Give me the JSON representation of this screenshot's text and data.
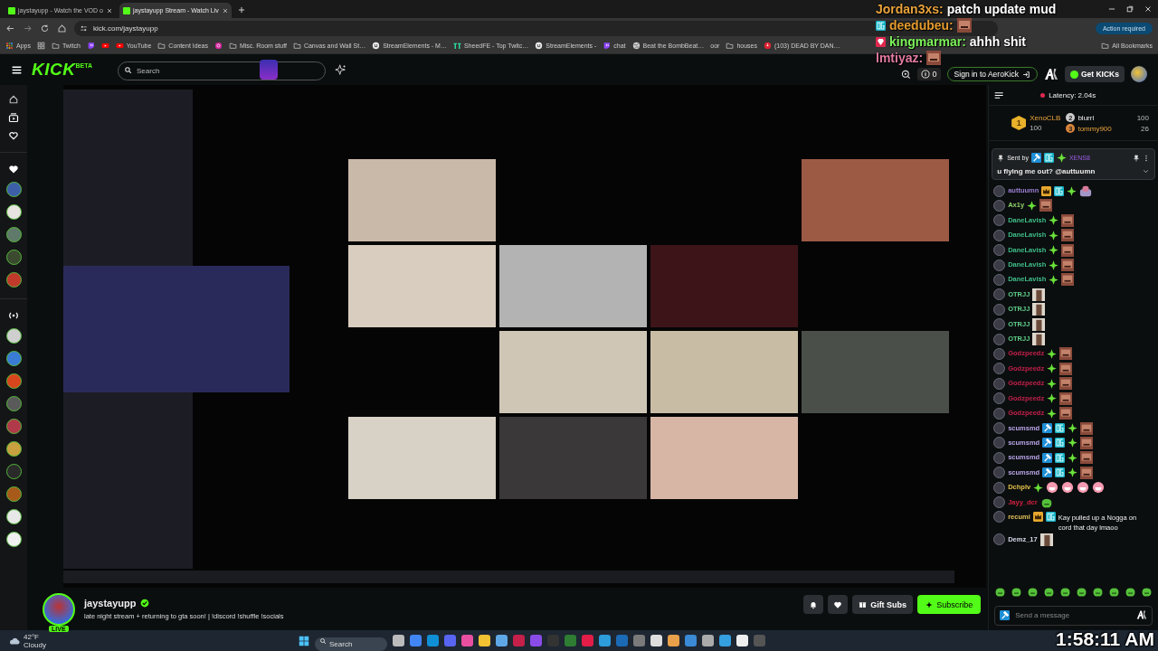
{
  "browser": {
    "tabs": [
      {
        "title": "jaystayupp - Watch the VOD o",
        "selected": false
      },
      {
        "title": "jaystayupp Stream - Watch Liv",
        "selected": true
      }
    ],
    "url": "kick.com/jaystayupp",
    "action_button": "Action required",
    "bookmarks": [
      {
        "kind": "apps",
        "label": "Apps"
      },
      {
        "kind": "grid"
      },
      {
        "kind": "folder",
        "label": "Twitch"
      },
      {
        "kind": "twitch"
      },
      {
        "kind": "youtube"
      },
      {
        "kind": "youtube",
        "label": "YouTube"
      },
      {
        "kind": "folder",
        "label": "Content Ideas"
      },
      {
        "kind": "instagram"
      },
      {
        "kind": "folder",
        "label": "Misc. Room stuff"
      },
      {
        "kind": "folder",
        "label": "Canvas and Wall St…"
      },
      {
        "kind": "face",
        "label": "StreamElements - M…"
      },
      {
        "kind": "tt",
        "label": "SheedFE - Top Twitc…"
      },
      {
        "kind": "face",
        "label": "StreamElements -"
      },
      {
        "kind": "twitch",
        "label": "chat"
      },
      {
        "kind": "globe",
        "label": "Beat the BombBeat…"
      },
      {
        "kind": "plain",
        "label": "oor"
      },
      {
        "kind": "folder",
        "label": "houses"
      },
      {
        "kind": "red",
        "label": "(103) DEAD BY DAN…"
      }
    ],
    "all_bookmarks": "All Bookmarks"
  },
  "header": {
    "logo": "KICK",
    "logo_badge": "BETA",
    "search": {
      "placeholder": "Search"
    },
    "counter": "0",
    "sign_in": "Sign in to AeroKick",
    "get_kicks": "Get KICKs"
  },
  "stream_overlay": [
    {
      "user": "Jordan3xs:",
      "color": "#e9a23b",
      "parts": [
        {
          "kind": "text",
          "text": "patch update mud"
        }
      ]
    },
    {
      "badge": {
        "kind": "og"
      },
      "user": "deedubeu:",
      "color": "#e39b2e",
      "parts": [
        {
          "kind": "emote"
        }
      ]
    },
    {
      "badge": {
        "kind": "gem"
      },
      "user": "kingmarmar:",
      "color": "#7cf25a",
      "parts": [
        {
          "kind": "text",
          "text": "ahhh shit"
        }
      ]
    },
    {
      "user": "lmtiyaz:",
      "color": "#e07aa0",
      "parts": [
        {
          "kind": "emote"
        }
      ]
    }
  ],
  "channel": {
    "name": "jaystayupp",
    "verified": true,
    "live_badge": "LIVE",
    "title": "late night stream + returning to gta soon!  | !discord !shuffle !socials",
    "gift_subs": "Gift Subs",
    "subscribe": "Subscribe"
  },
  "chat": {
    "latency": "Latency: 2.04s",
    "leaderboard": [
      {
        "rank": "1",
        "name": "XenoCLB",
        "amount": "100"
      },
      {
        "rank": "2",
        "name": "blurri",
        "amount": "100"
      },
      {
        "rank": "3",
        "name": "tommy900",
        "amount": "26"
      }
    ],
    "pinned": {
      "sent_by": "Sent by",
      "badges": [
        {
          "kind": "mod"
        },
        {
          "kind": "og"
        },
        {
          "kind": "sparkle"
        }
      ],
      "user": "XENS8",
      "message": "u flying me out? @auttuumn"
    },
    "messages": [
      {
        "user": "auttuumn",
        "color": "#9b7fd1",
        "badges": [
          {
            "kind": "founder"
          },
          {
            "kind": "og"
          },
          {
            "kind": "sparkle"
          }
        ],
        "parts": [
          {
            "kind": "sticker"
          }
        ]
      },
      {
        "user": "Ax1y",
        "color": "#8fd16a",
        "badges": [
          {
            "kind": "sparkle"
          }
        ],
        "parts": [
          {
            "kind": "emote"
          }
        ]
      },
      {
        "user": "DaneLavish",
        "color": "#3fbf8a",
        "badges": [
          {
            "kind": "sparkle"
          }
        ],
        "parts": [
          {
            "kind": "emote"
          }
        ]
      },
      {
        "user": "DaneLavish",
        "color": "#3fbf8a",
        "badges": [
          {
            "kind": "sparkle"
          }
        ],
        "parts": [
          {
            "kind": "emote"
          }
        ]
      },
      {
        "user": "DaneLavish",
        "color": "#3fbf8a",
        "badges": [
          {
            "kind": "sparkle"
          }
        ],
        "parts": [
          {
            "kind": "emote"
          }
        ]
      },
      {
        "user": "DaneLavish",
        "color": "#3fbf8a",
        "badges": [
          {
            "kind": "sparkle"
          }
        ],
        "parts": [
          {
            "kind": "emote"
          }
        ]
      },
      {
        "user": "DaneLavish",
        "color": "#3fbf8a",
        "badges": [
          {
            "kind": "sparkle"
          }
        ],
        "parts": [
          {
            "kind": "emote"
          }
        ]
      },
      {
        "user": "OTRJJ",
        "color": "#5fd08a"
      },
      {
        "user": "OTRJJ",
        "color": "#5fd08a"
      },
      {
        "user": "OTRJJ",
        "color": "#5fd08a"
      },
      {
        "user": "OTRJJ",
        "color": "#5fd08a"
      },
      {
        "user": "Godzpeedz",
        "color": "#c0204a",
        "badges": [
          {
            "kind": "sparkle"
          }
        ],
        "parts": [
          {
            "kind": "emote"
          }
        ]
      },
      {
        "user": "Godzpeedz",
        "color": "#c0204a",
        "badges": [
          {
            "kind": "sparkle"
          }
        ],
        "parts": [
          {
            "kind": "emote"
          }
        ]
      },
      {
        "user": "Godzpeedz",
        "color": "#c0204a",
        "badges": [
          {
            "kind": "sparkle"
          }
        ],
        "parts": [
          {
            "kind": "emote"
          }
        ]
      },
      {
        "user": "Godzpeedz",
        "color": "#c0204a",
        "badges": [
          {
            "kind": "sparkle"
          }
        ],
        "parts": [
          {
            "kind": "emote"
          }
        ]
      },
      {
        "user": "Godzpeedz",
        "color": "#c0204a",
        "badges": [
          {
            "kind": "sparkle"
          }
        ],
        "parts": [
          {
            "kind": "emote"
          }
        ]
      },
      {
        "user": "scumsmd",
        "color": "#b9a5e8",
        "badges": [
          {
            "kind": "mod"
          },
          {
            "kind": "og"
          },
          {
            "kind": "sparkle"
          }
        ],
        "parts": [
          {
            "kind": "emote"
          }
        ]
      },
      {
        "user": "scumsmd",
        "color": "#b9a5e8",
        "badges": [
          {
            "kind": "mod"
          },
          {
            "kind": "og"
          },
          {
            "kind": "sparkle"
          }
        ],
        "parts": [
          {
            "kind": "emote"
          }
        ]
      },
      {
        "user": "scumsmd",
        "color": "#b9a5e8",
        "badges": [
          {
            "kind": "mod"
          },
          {
            "kind": "og"
          },
          {
            "kind": "sparkle"
          }
        ],
        "parts": [
          {
            "kind": "emote"
          }
        ]
      },
      {
        "user": "scumsmd",
        "color": "#b9a5e8",
        "badges": [
          {
            "kind": "mod"
          },
          {
            "kind": "og"
          },
          {
            "kind": "sparkle"
          }
        ],
        "parts": [
          {
            "kind": "emote"
          }
        ]
      },
      {
        "user": "Dchplv",
        "color": "#e3c04a",
        "badges": [
          {
            "kind": "sparkle"
          }
        ],
        "parts": [
          {
            "kind": "emoji"
          },
          {
            "kind": "emoji"
          },
          {
            "kind": "emoji"
          },
          {
            "kind": "emoji"
          }
        ]
      },
      {
        "user": "Jayy_dcr",
        "color": "#d02040",
        "parts": [
          {
            "kind": "pepe"
          }
        ]
      },
      {
        "user": "recumi",
        "color": "#e0c05a",
        "badges": [
          {
            "kind": "founder"
          },
          {
            "kind": "og"
          }
        ],
        "parts": [
          {
            "kind": "text",
            "text": "Kay pulled up a Nogga on cord that day lmaoo"
          }
        ]
      },
      {
        "user": "Demz_17",
        "color": "#d8d8e8"
      }
    ],
    "input": {
      "placeholder": "Send a message"
    }
  },
  "taskbar": {
    "temperature": "42°F",
    "weather": "Cloudy",
    "search": {
      "placeholder": "Search"
    },
    "clock": "1:58:11 AM"
  }
}
